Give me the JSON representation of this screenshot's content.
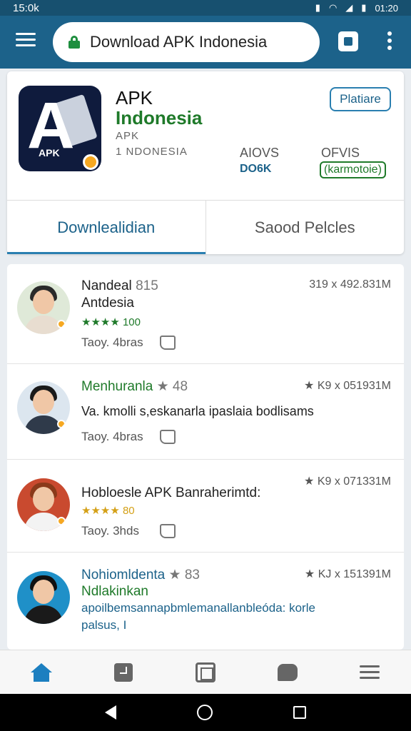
{
  "status_bar": {
    "time_left": "15:0k",
    "time_right": "01:20"
  },
  "browser": {
    "url_text": "Download APK Indonesia"
  },
  "app": {
    "title_line1": "APK",
    "title_line2": "Indonesia",
    "subtitle_line1": "APK",
    "subtitle_line2": "1 NDONESIA",
    "platform_button": "Platiare",
    "meta_a_label": "AIOVS",
    "meta_a_value": "DO6K",
    "meta_b_label": "OFVIS",
    "meta_b_value": "(karmotoie)"
  },
  "tabs": [
    {
      "label": "Downlealidian"
    },
    {
      "label": "Saood Pelcles"
    }
  ],
  "list": [
    {
      "name": "Nandeal",
      "name_suffix": "815",
      "name_line2": "Antdesia",
      "stat": "319 x 492.831M",
      "rating": "★★★★ 100",
      "time": "Taoy. 4bras"
    },
    {
      "name": "Menhuranla",
      "name_suffix": "★ 48",
      "stat": "★ K9 x 051931M",
      "text": "Va. kmolli s,eskanarla ipaslaia bodlisams",
      "time": "Taoy. 4bras"
    },
    {
      "name": "Hobloesle APK Banraherimtd:",
      "stat": "★ K9 x 071331M",
      "rating": "★★★★ 80",
      "time": "Taoy. 3hds"
    },
    {
      "name": "Nohiomldenta",
      "name_suffix": "★ 83",
      "stat": "★ KJ x 151391M",
      "name_line2": "Ndlakinkan",
      "text_line1": "apoilbemsannapbmlemanallanbleóda: korle",
      "text_line2": "palsus, I"
    }
  ],
  "colors": {
    "app_bar": "#1c628a",
    "accent_green": "#1f7a2a",
    "accent_blue": "#2a7fb0"
  },
  "icons": [
    "menu-icon",
    "lock-icon",
    "tab-switch-icon",
    "more-vert-icon",
    "home-icon",
    "calendar-icon",
    "grid-icon",
    "chat-icon",
    "hamburger-icon"
  ]
}
